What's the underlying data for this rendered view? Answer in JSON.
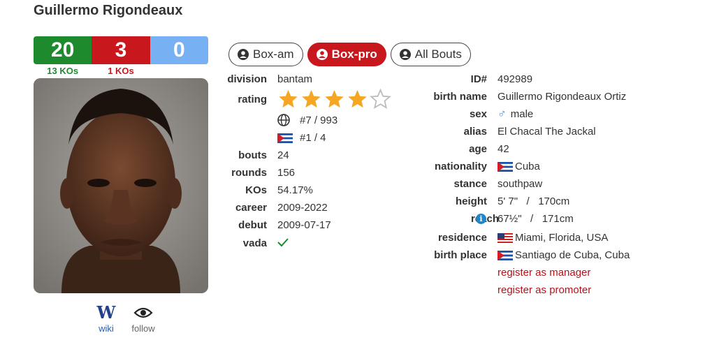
{
  "boxer": {
    "name": "Guillermo Rigondeaux",
    "record": {
      "wins": "20",
      "losses": "3",
      "draws": "0",
      "win_kos": "13 KOs",
      "loss_kos": "1 KOs"
    }
  },
  "tabs": [
    {
      "label": "Box-am",
      "active": false
    },
    {
      "label": "Box-pro",
      "active": true
    },
    {
      "label": "All Bouts",
      "active": false
    }
  ],
  "links": {
    "wiki": "wiki",
    "follow": "follow"
  },
  "left_info": {
    "division_label": "division",
    "division": "bantam",
    "rating_label": "rating",
    "rating_stars": 4,
    "rating_max": 5,
    "world_rank": "#7 / 993",
    "country_rank": "#1 / 4",
    "bouts_label": "bouts",
    "bouts": "24",
    "rounds_label": "rounds",
    "rounds": "156",
    "kos_label": "KOs",
    "kos": "54.17%",
    "career_label": "career",
    "career": "2009-2022",
    "debut_label": "debut",
    "debut": "2009-07-17",
    "vada_label": "vada"
  },
  "right_info": {
    "id_label": "ID#",
    "id": "492989",
    "birthname_label": "birth name",
    "birthname": "Guillermo Rigondeaux Ortiz",
    "sex_label": "sex",
    "sex": "male",
    "alias_label": "alias",
    "alias": "El Chacal The Jackal",
    "age_label": "age",
    "age": "42",
    "nationality_label": "nationality",
    "nationality": "Cuba",
    "stance_label": "stance",
    "stance": "southpaw",
    "height_label": "height",
    "height": "5' 7\"   /   170cm",
    "reach_label": "reach",
    "reach": "67½\"   /   171cm",
    "residence_label": "residence",
    "residence": "Miami, Florida, USA",
    "birthplace_label": "birth place",
    "birthplace": "Santiago de Cuba, Cuba",
    "register_manager": "register as manager",
    "register_promoter": "register as promoter"
  },
  "colors": {
    "win": "#1e8a2e",
    "loss": "#c8181e",
    "draw": "#78b0f4",
    "star": "#f5a623",
    "link": "#b3141c"
  }
}
